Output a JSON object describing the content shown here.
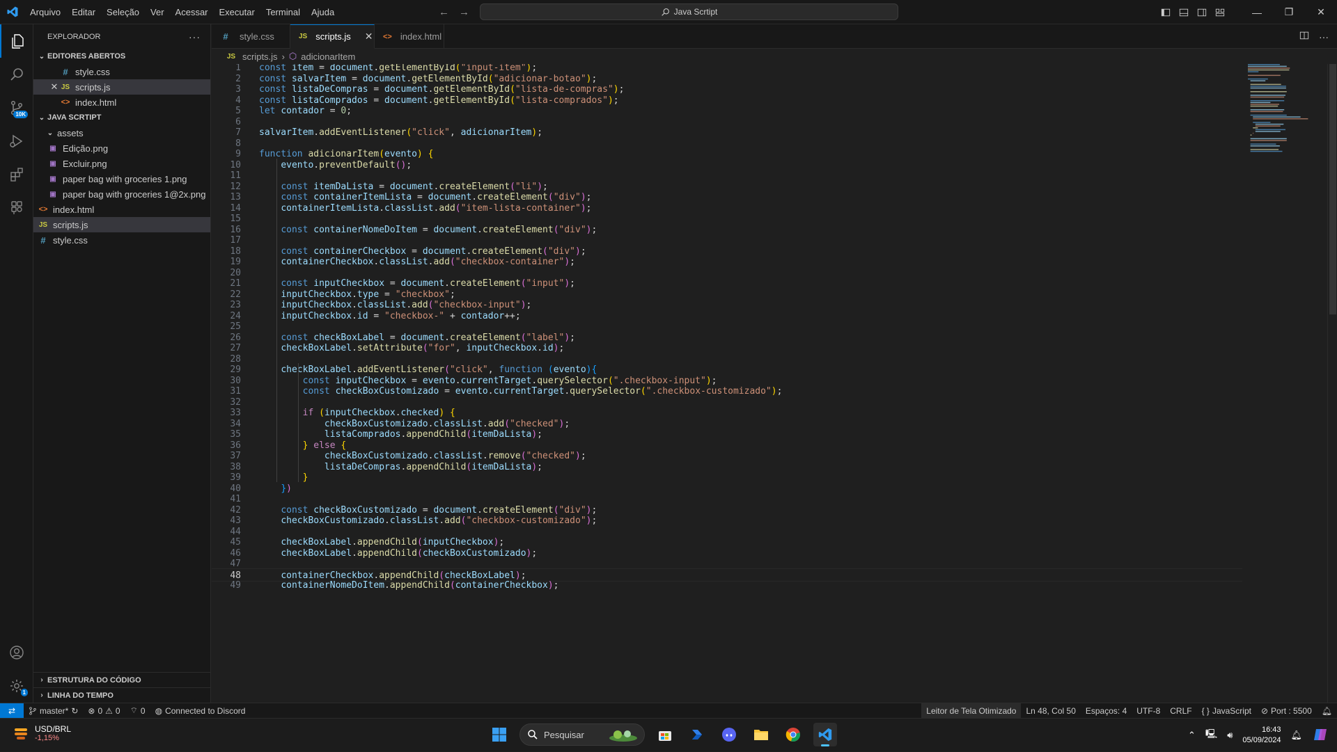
{
  "titlebar": {
    "menu": [
      "Arquivo",
      "Editar",
      "Seleção",
      "Ver",
      "Acessar",
      "Executar",
      "Terminal",
      "Ajuda"
    ],
    "search": "Java Scrtipt"
  },
  "activity": {
    "scm_badge": "10K",
    "settings_badge": "1"
  },
  "explorer": {
    "title": "EXPLORADOR",
    "open_editors_title": "EDITORES ABERTOS",
    "open_editors": [
      {
        "name": "style.css",
        "type": "css"
      },
      {
        "name": "scripts.js",
        "type": "js"
      },
      {
        "name": "index.html",
        "type": "html"
      }
    ],
    "project_title": "JAVA SCRTIPT",
    "folder": "assets",
    "assets": [
      "Edição.png",
      "Excluir.png",
      "paper bag with groceries 1.png",
      "paper bag with groceries 1@2x.png"
    ],
    "files": [
      {
        "name": "index.html",
        "type": "html"
      },
      {
        "name": "scripts.js",
        "type": "js"
      },
      {
        "name": "style.css",
        "type": "css"
      }
    ],
    "outline_title": "ESTRUTURA DO CÓDIGO",
    "timeline_title": "LINHA DO TEMPO"
  },
  "tabs": [
    {
      "name": "style.css",
      "type": "css"
    },
    {
      "name": "scripts.js",
      "type": "js"
    },
    {
      "name": "index.html",
      "type": "html"
    }
  ],
  "breadcrumb": {
    "file": "scripts.js",
    "symbol": "adicionarItem"
  },
  "editor": {
    "current_line": 48,
    "lines": [
      "const item = document.getElementById(\"input-item\");",
      "const salvarItem = document.getElementById(\"adicionar-botao\");",
      "const listaDeCompras = document.getElementById(\"lista-de-compras\");",
      "const listaComprados = document.getElementById(\"lista-comprados\");",
      "let contador = 0;",
      "",
      "salvarItem.addEventListener(\"click\", adicionarItem);",
      "",
      "function adicionarItem(evento) {",
      "    evento.preventDefault();",
      "",
      "    const itemDaLista = document.createElement(\"li\");",
      "    const containerItemLista = document.createElement(\"div\");",
      "    containerItemLista.classList.add(\"item-lista-container\");",
      "",
      "    const containerNomeDoItem = document.createElement(\"div\");",
      "",
      "    const containerCheckbox = document.createElement(\"div\");",
      "    containerCheckbox.classList.add(\"checkbox-container\");",
      "",
      "    const inputCheckbox = document.createElement(\"input\");",
      "    inputCheckbox.type = \"checkbox\";",
      "    inputCheckbox.classList.add(\"checkbox-input\");",
      "    inputCheckbox.id = \"checkbox-\" + contador++;",
      "",
      "    const checkBoxLabel = document.createElement(\"label\");",
      "    checkBoxLabel.setAttribute(\"for\", inputCheckbox.id);",
      "",
      "    checkBoxLabel.addEventListener(\"click\", function (evento){",
      "        const inputCheckbox = evento.currentTarget.querySelector(\".checkbox-input\");",
      "        const checkBoxCustomizado = evento.currentTarget.querySelector(\".checkbox-customizado\");",
      "",
      "        if (inputCheckbox.checked) {",
      "            checkBoxCustomizado.classList.add(\"checked\");",
      "            listaComprados.appendChild(itemDaLista);",
      "        } else {",
      "            checkBoxCustomizado.classList.remove(\"checked\");",
      "            listaDeCompras.appendChild(itemDaLista);",
      "        }",
      "    })",
      "",
      "    const checkBoxCustomizado = document.createElement(\"div\");",
      "    checkBoxCustomizado.classList.add(\"checkbox-customizado\");",
      "",
      "    checkBoxLabel.appendChild(inputCheckbox);",
      "    checkBoxLabel.appendChild(checkBoxCustomizado);",
      "",
      "    containerCheckbox.appendChild(checkBoxLabel);",
      "    containerNomeDoItem.appendChild(containerCheckbox);"
    ]
  },
  "statusbar": {
    "branch": "master*",
    "errors": "0",
    "warnings": "0",
    "ports": "0",
    "discord": "Connected to Discord",
    "screen_reader": "Leitor de Tela Otimizado",
    "position": "Ln 48, Col 50",
    "spaces": "Espaços: 4",
    "encoding": "UTF-8",
    "eol": "CRLF",
    "language": "JavaScript",
    "port": "Port : 5500"
  },
  "taskbar": {
    "ticker": "USD/BRL",
    "change": "-1,15%",
    "search": "Pesquisar",
    "time": "16:43",
    "date": "05/09/2024"
  },
  "colors": {
    "accent": "#0078d4",
    "keyword": "#569cd6",
    "function": "#dcdcaa",
    "variable": "#9cdcfe",
    "string": "#ce9178"
  }
}
